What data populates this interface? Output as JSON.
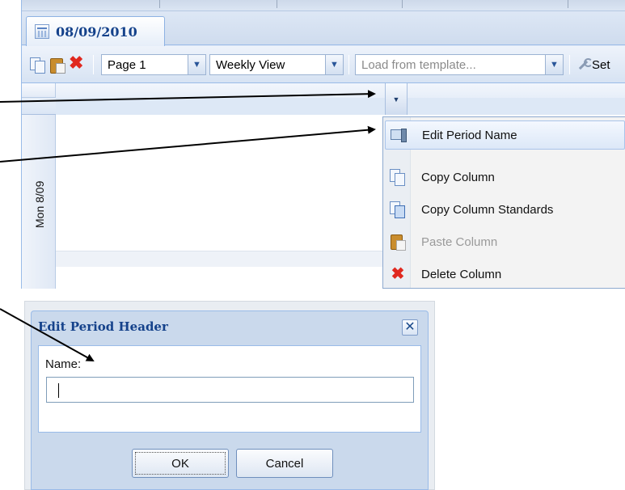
{
  "tab": {
    "label": "08/09/2010",
    "icon": "calendar-icon"
  },
  "toolbar": {
    "page_select": "Page 1",
    "view_select": "Weekly View",
    "template_placeholder": "Load from template...",
    "settings_label": "Set"
  },
  "grid": {
    "row_label": "Mon 8/09"
  },
  "context_menu": {
    "items": [
      {
        "label": "Edit Period Name",
        "icon": "edit-period-icon",
        "state": "highlighted"
      },
      {
        "label": "Copy Column",
        "icon": "copy-icon",
        "state": "enabled"
      },
      {
        "label": "Copy Column Standards",
        "icon": "copy-standards-icon",
        "state": "enabled"
      },
      {
        "label": "Paste Column",
        "icon": "paste-icon",
        "state": "disabled"
      },
      {
        "label": "Delete Column",
        "icon": "delete-icon",
        "state": "enabled"
      }
    ]
  },
  "dialog": {
    "title": "Edit Period Header",
    "close_label": "✕",
    "name_label": "Name:",
    "name_value": "",
    "ok_label": "OK",
    "cancel_label": "Cancel"
  },
  "colors": {
    "title_blue": "#15428b",
    "header_bg": "#dfe8f6",
    "delete_red": "#e0281f"
  }
}
